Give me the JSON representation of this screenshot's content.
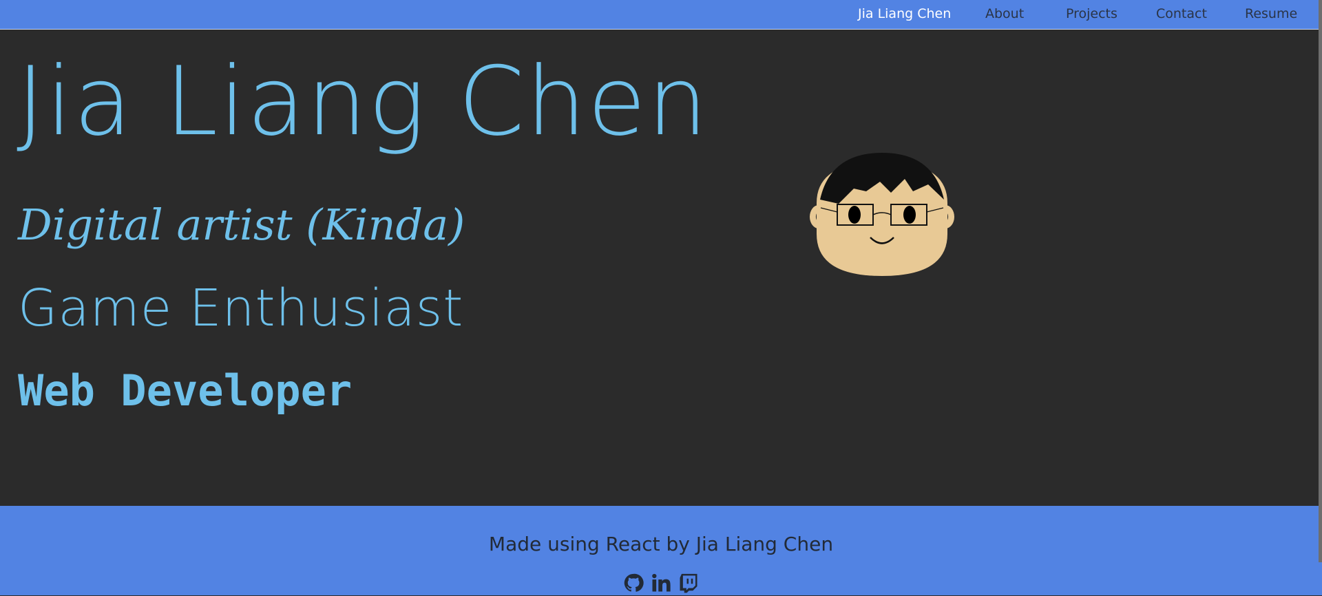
{
  "nav": {
    "brand": "Jia Liang Chen",
    "links": [
      "About",
      "Projects",
      "Contact",
      "Resume"
    ]
  },
  "hero": {
    "title": "Jia Liang Chen",
    "taglines": [
      "Digital artist (Kinda)",
      "Game Enthusiast",
      "Web Developer"
    ]
  },
  "footer": {
    "text": "Made using React by Jia Liang Chen",
    "icons": [
      "github-icon",
      "linkedin-icon",
      "twitch-icon"
    ]
  },
  "colors": {
    "navbar": "#5283e3",
    "background": "#2b2b2b",
    "accent": "#6ec0ea"
  }
}
